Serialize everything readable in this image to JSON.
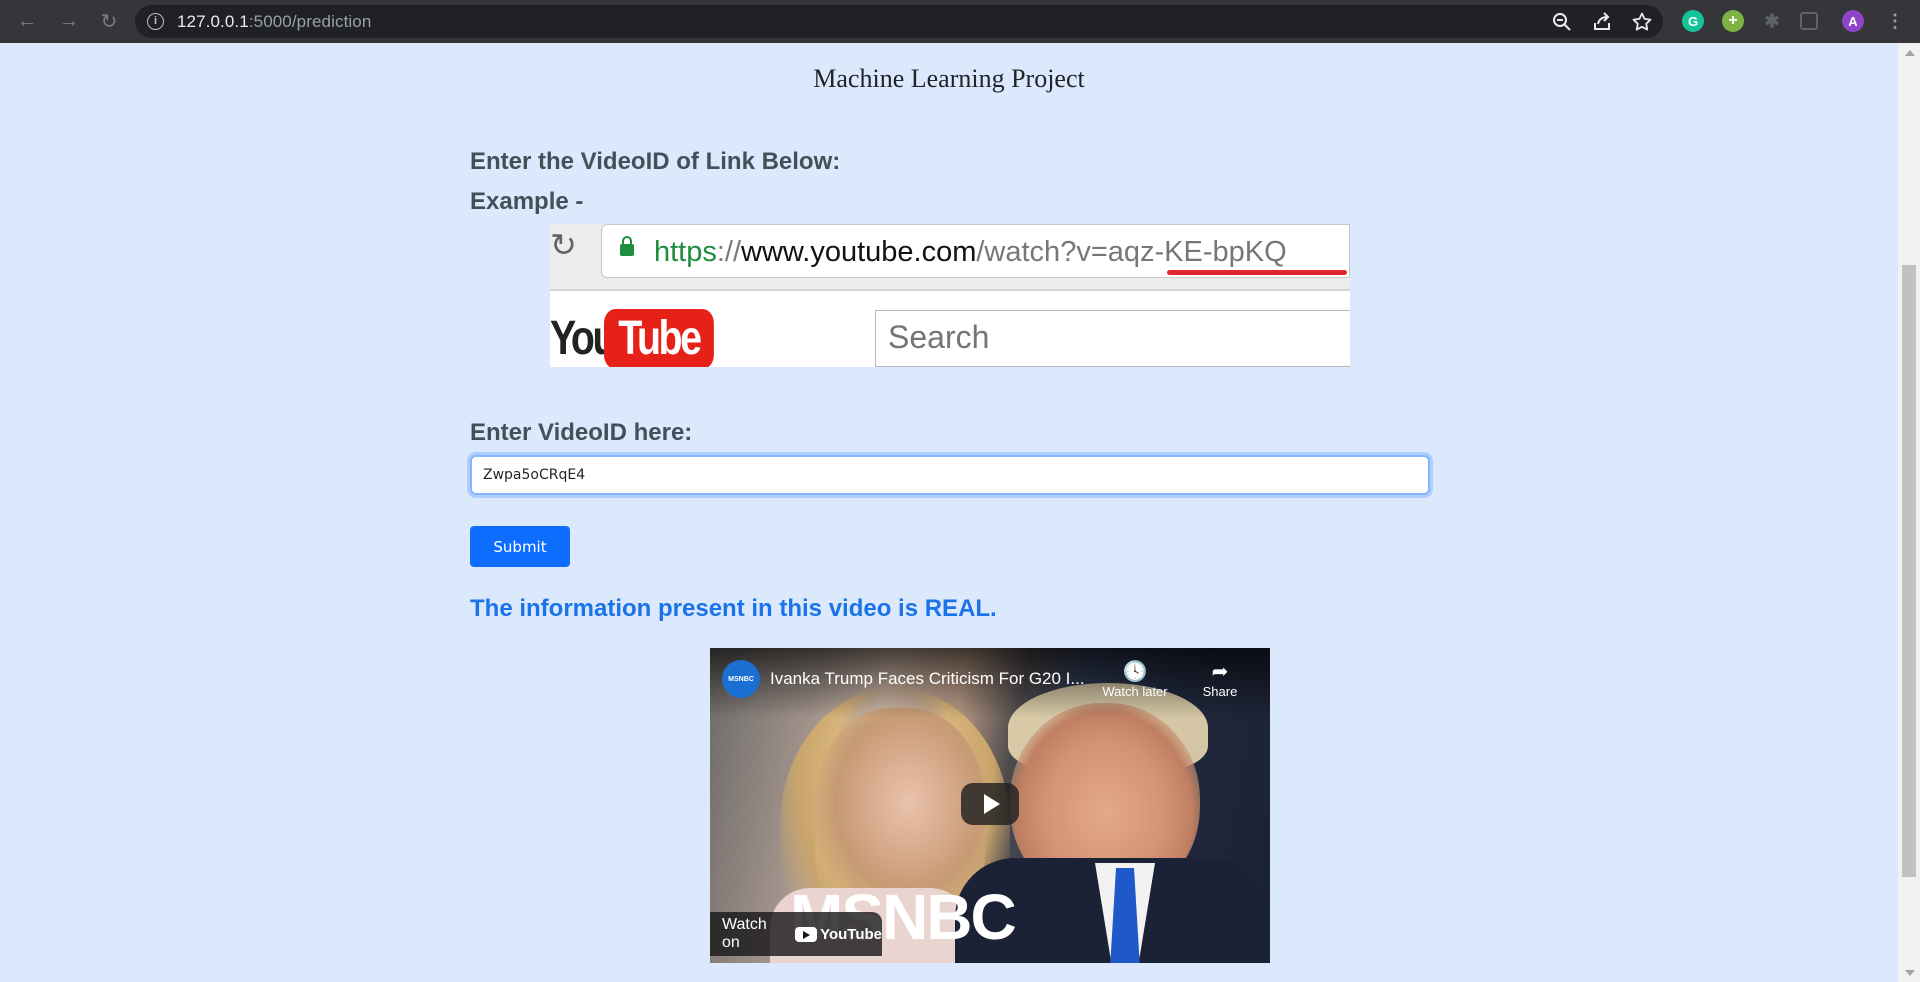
{
  "browser": {
    "url_host": "127.0.0.1",
    "url_path": ":5000/prediction",
    "profile_initial": "A",
    "grammarly_initial": "G"
  },
  "page": {
    "title": "Machine Learning Project",
    "enter_label": "Enter the VideoID of Link Below:",
    "example_label": "Example -",
    "videoid_label": "Enter VideoID here:",
    "videoid_value": "Zwpa5oCRqE4",
    "submit_label": "Submit",
    "result_text": "The information present in this video is REAL."
  },
  "example_image": {
    "url_scheme": "https",
    "url_sep": "://",
    "url_domain": "www.youtube.com",
    "url_rest_prefix": "/watch?v=",
    "url_video_id": "aqz-KE-bpKQ",
    "logo_you": "You",
    "logo_tube": "Tube",
    "search_placeholder": "Search"
  },
  "video": {
    "channel_badge": "MSNBC",
    "title": "Ivanka Trump Faces Criticism For G20 I...",
    "watch_later_label": "Watch later",
    "share_label": "Share",
    "logo_text": "MSNBC",
    "watch_on_label": "Watch on",
    "youtube_label": "YouTube"
  },
  "colors": {
    "page_bg": "#dce9fd",
    "result_blue": "#1a73e8",
    "button_blue": "#0d6efd",
    "youtube_red": "#e62117"
  },
  "icons": {
    "back": "arrow-left",
    "forward": "arrow-right",
    "reload": "reload",
    "info": "info-circle",
    "zoom": "magnifier-minus",
    "share": "share-arrow",
    "bookmark": "star",
    "extensions": "puzzle",
    "side_panel": "sidebar",
    "menu": "vertical-dots"
  }
}
